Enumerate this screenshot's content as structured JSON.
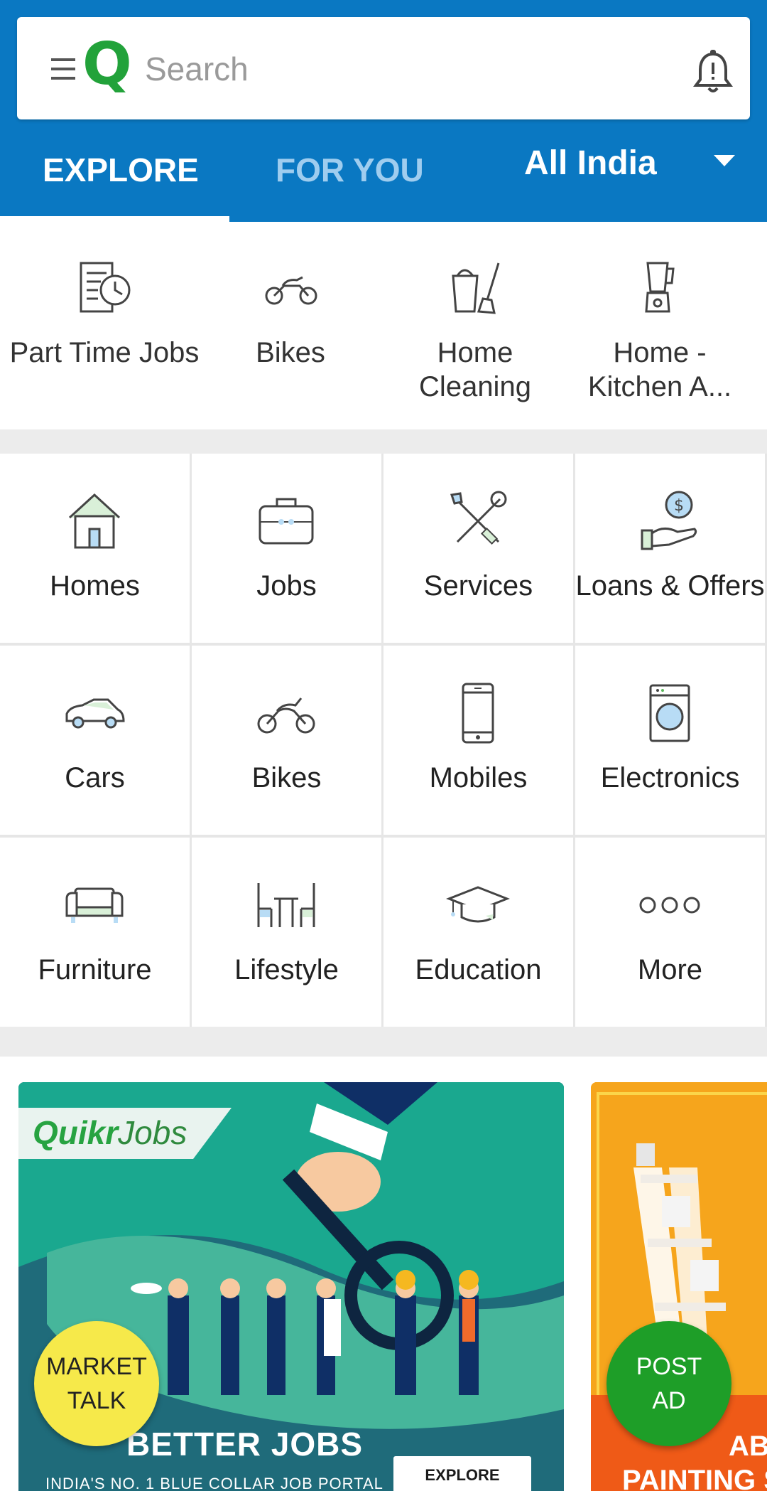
{
  "header": {
    "search_placeholder": "Search",
    "logo_letter": "Q",
    "tabs": [
      {
        "label": "EXPLORE",
        "active": true
      },
      {
        "label": "FOR YOU",
        "active": false
      }
    ],
    "location": "All India",
    "icons": {
      "menu": "hamburger-menu-icon",
      "notifications": "bell-icon"
    }
  },
  "quick_categories": [
    {
      "label": "Part Time Jobs",
      "icon": "part-time-jobs-icon"
    },
    {
      "label": "Bikes",
      "icon": "motorbike-icon"
    },
    {
      "label": "Home Cleaning",
      "icon": "home-cleaning-icon"
    },
    {
      "label": "Home - Kitchen A...",
      "icon": "blender-icon"
    }
  ],
  "categories": [
    {
      "label": "Homes",
      "icon": "house-icon"
    },
    {
      "label": "Jobs",
      "icon": "briefcase-icon"
    },
    {
      "label": "Services",
      "icon": "tools-icon"
    },
    {
      "label": "Loans & Offers",
      "icon": "loan-icon"
    },
    {
      "label": "Cars",
      "icon": "car-icon"
    },
    {
      "label": "Bikes",
      "icon": "motorbike-icon"
    },
    {
      "label": "Mobiles",
      "icon": "mobile-icon"
    },
    {
      "label": "Electronics",
      "icon": "washing-machine-icon"
    },
    {
      "label": "Furniture",
      "icon": "sofa-icon"
    },
    {
      "label": "Lifestyle",
      "icon": "table-chairs-icon"
    },
    {
      "label": "Education",
      "icon": "graduation-cap-icon"
    },
    {
      "label": "More",
      "icon": "more-dots-icon"
    }
  ],
  "banners": {
    "jobs": {
      "brand": "Quikr",
      "brand_suffix": "Jobs",
      "headline": "BETTER JOBS",
      "subline": "INDIA'S NO. 1 BLUE COLLAR JOB PORTAL",
      "button": "EXPLORE"
    },
    "paint": {
      "line1": "ABL",
      "line2": "PAINTING S"
    }
  },
  "fabs": {
    "market_talk_line1": "MARKET",
    "market_talk_line2": "TALK",
    "post_ad_line1": "POST",
    "post_ad_line2": "AD"
  },
  "colors": {
    "header_blue": "#0a78c2",
    "brand_green": "#22a23a",
    "tab_inactive": "#9fcdef",
    "fab_yellow": "#f6e94a",
    "fab_green": "#1e9e28"
  }
}
